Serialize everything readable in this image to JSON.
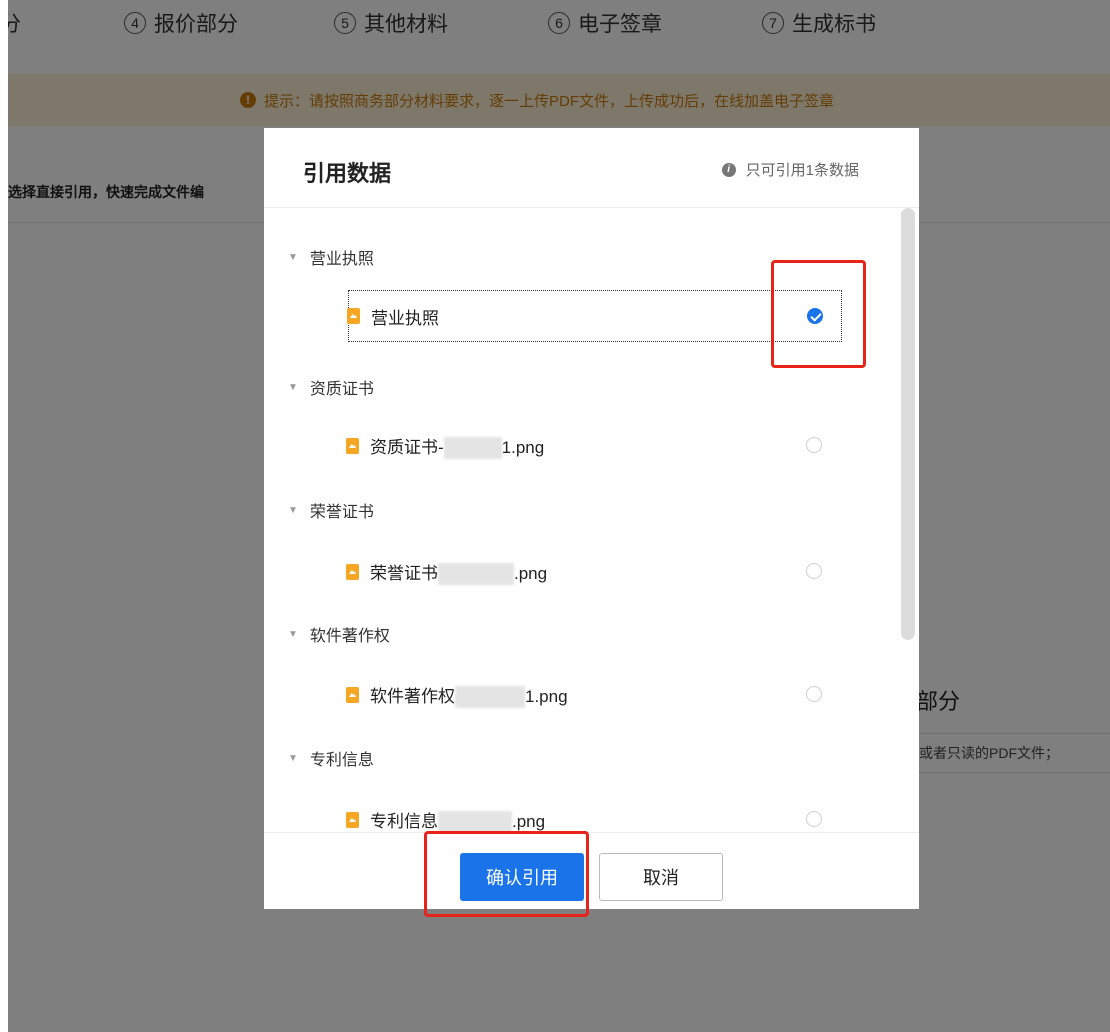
{
  "steps": [
    {
      "num": "",
      "label": "分"
    },
    {
      "num": "4",
      "label": "报价部分"
    },
    {
      "num": "5",
      "label": "其他材料"
    },
    {
      "num": "6",
      "label": "电子签章"
    },
    {
      "num": "7",
      "label": "生成标书"
    }
  ],
  "tip": "提示：请按照商务部分材料要求，逐一上传PDF文件，上传成功后，在线加盖电子签章",
  "hint": "选择直接引用，快速完成文件编",
  "section_title": "部分",
  "note": "或者只读的PDF文件；",
  "modal": {
    "title": "引用数据",
    "note": "只可引用1条数据",
    "groups": [
      {
        "label": "营业执照",
        "file": {
          "prefix": "营业执照",
          "suffix": "",
          "selected": true
        }
      },
      {
        "label": "资质证书",
        "file": {
          "prefix": "资质证书-",
          "suffix": "1.png",
          "selected": false
        }
      },
      {
        "label": "荣誉证书",
        "file": {
          "prefix": "荣誉证书",
          "suffix": ".png",
          "selected": false
        }
      },
      {
        "label": "软件著作权",
        "file": {
          "prefix": "软件著作权",
          "suffix": "1.png",
          "selected": false
        }
      },
      {
        "label": "专利信息",
        "file": {
          "prefix": "专利信息",
          "suffix": ".png",
          "selected": false
        }
      }
    ],
    "confirm_label": "确认引用",
    "cancel_label": "取消"
  },
  "colors": {
    "primary": "#1a73e8",
    "annotation": "#e8231a",
    "tip_bg": "#fdf0d6",
    "tip_text": "#c97a08"
  }
}
